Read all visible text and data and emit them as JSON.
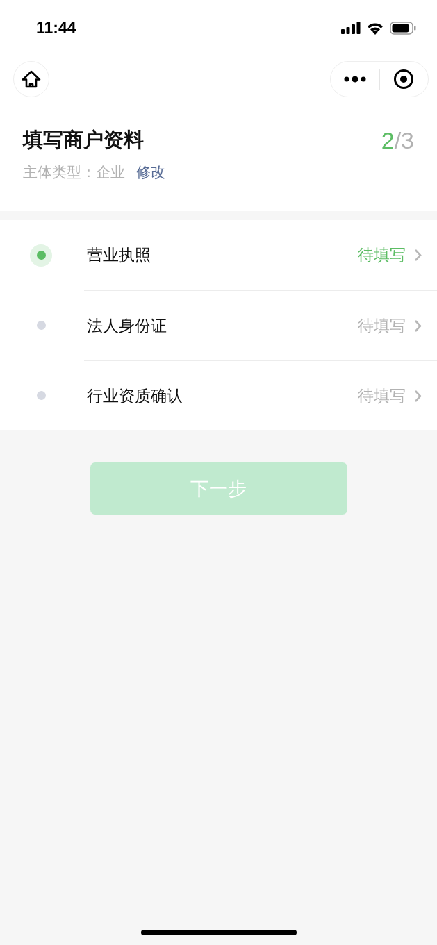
{
  "status_bar": {
    "time": "11:44"
  },
  "header": {
    "title": "填写商户资料",
    "progress_current": "2",
    "progress_rest": "/3",
    "subject_label": "主体类型：",
    "subject_value": "企业",
    "edit_link": "修改"
  },
  "steps": [
    {
      "title": "营业执照",
      "status": "待填写",
      "active": true
    },
    {
      "title": "法人身份证",
      "status": "待填写",
      "active": false
    },
    {
      "title": "行业资质确认",
      "status": "待填写",
      "active": false
    }
  ],
  "next_button": {
    "label": "下一步",
    "disabled": true
  }
}
